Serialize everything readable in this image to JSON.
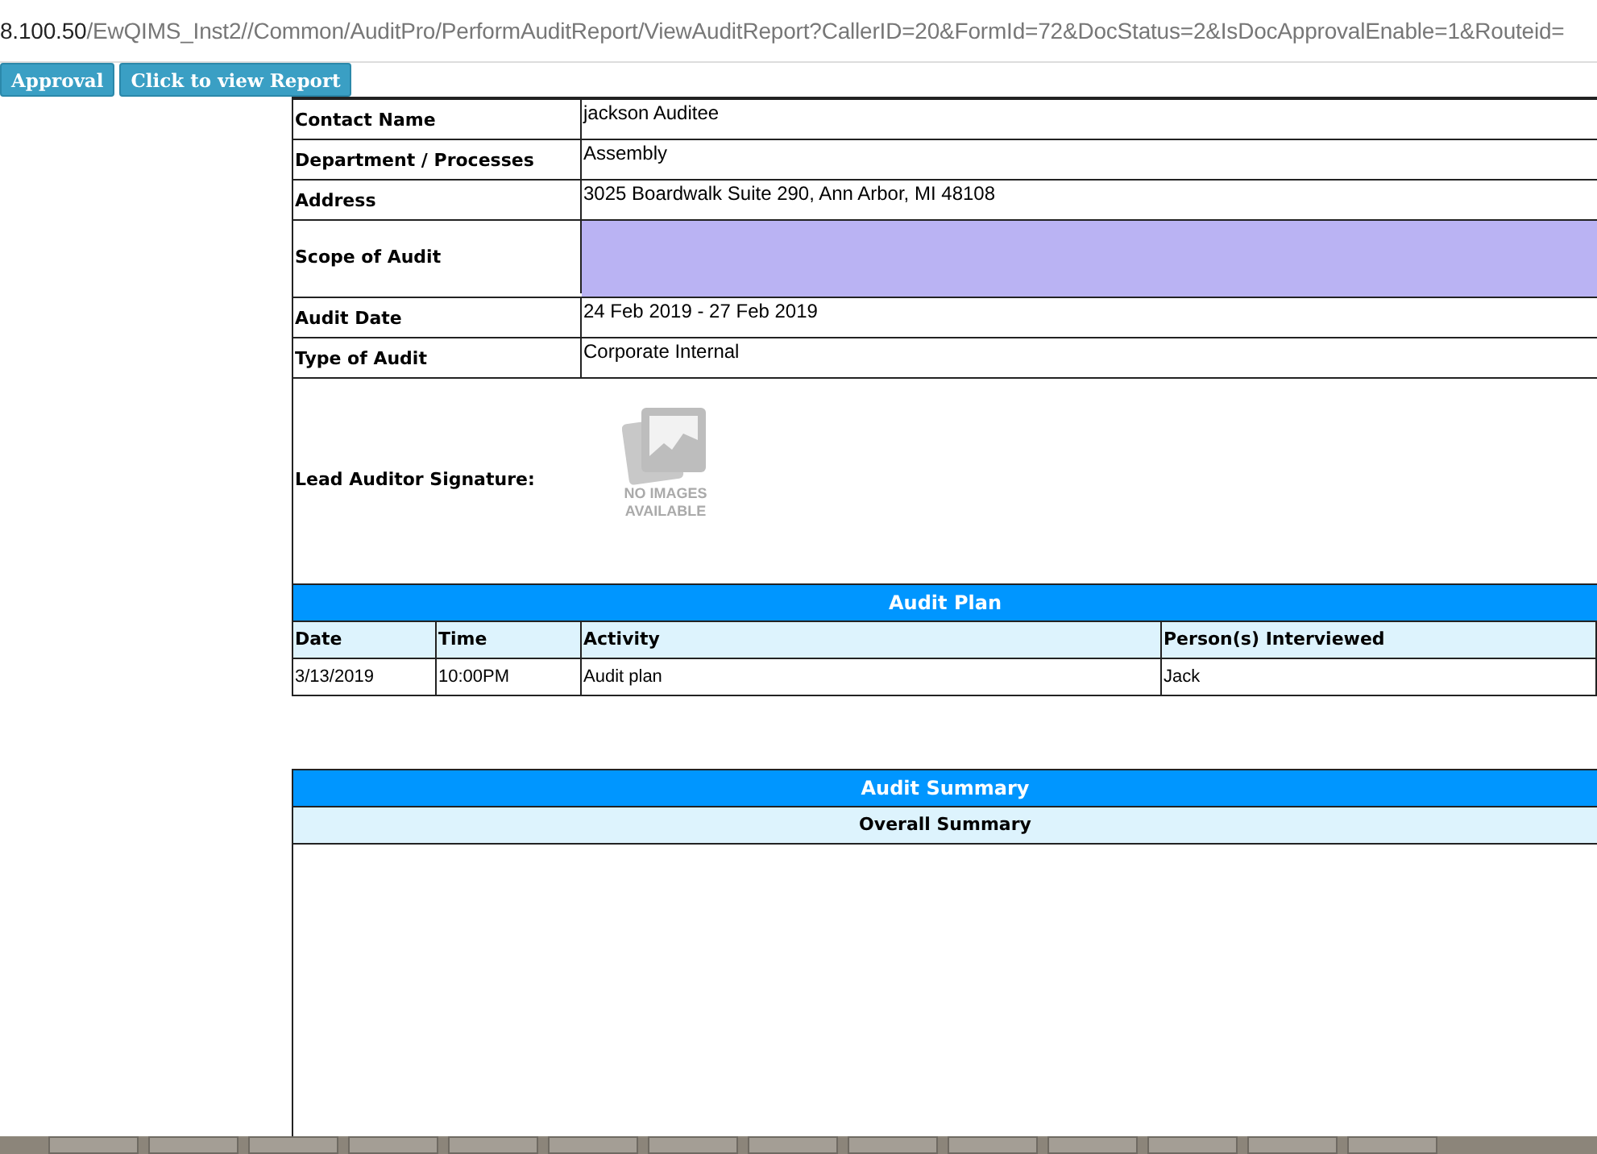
{
  "address_bar": {
    "host": "8.100.50",
    "path": "/EwQIMS_Inst2//Common/AuditPro/PerformAuditReport/ViewAuditReport?CallerID=20&FormId=72&DocStatus=2&IsDocApprovalEnable=1&Routeid="
  },
  "buttons": [
    "Approval",
    "Click to view Report"
  ],
  "details": [
    {
      "label": "Contact Name",
      "value": "jackson Auditee",
      "kind": "text"
    },
    {
      "label": "Department / Processes",
      "value": "Assembly",
      "kind": "text"
    },
    {
      "label": "Address",
      "value": "3025 Boardwalk Suite 290, Ann Arbor, MI 48108",
      "kind": "text"
    },
    {
      "label": "Scope of Audit",
      "kind": "shaded"
    },
    {
      "label": "Audit Date",
      "value": "24 Feb 2019 - 27 Feb 2019",
      "kind": "text"
    },
    {
      "label": "Type of Audit",
      "value": "Corporate Internal",
      "kind": "text"
    },
    {
      "label": "Lead Auditor Signature:",
      "value": "NO IMAGES AVAILABLE",
      "kind": "image"
    }
  ],
  "audit_plan": {
    "title": "Audit Plan",
    "columns": [
      "Date",
      "Time",
      "Activity",
      "Person(s) Interviewed"
    ],
    "rows": [
      [
        "3/13/2019",
        "10:00PM",
        "Audit plan",
        "Jack"
      ]
    ]
  },
  "audit_summary": {
    "title": "Audit Summary",
    "subtitle": "Overall Summary"
  }
}
